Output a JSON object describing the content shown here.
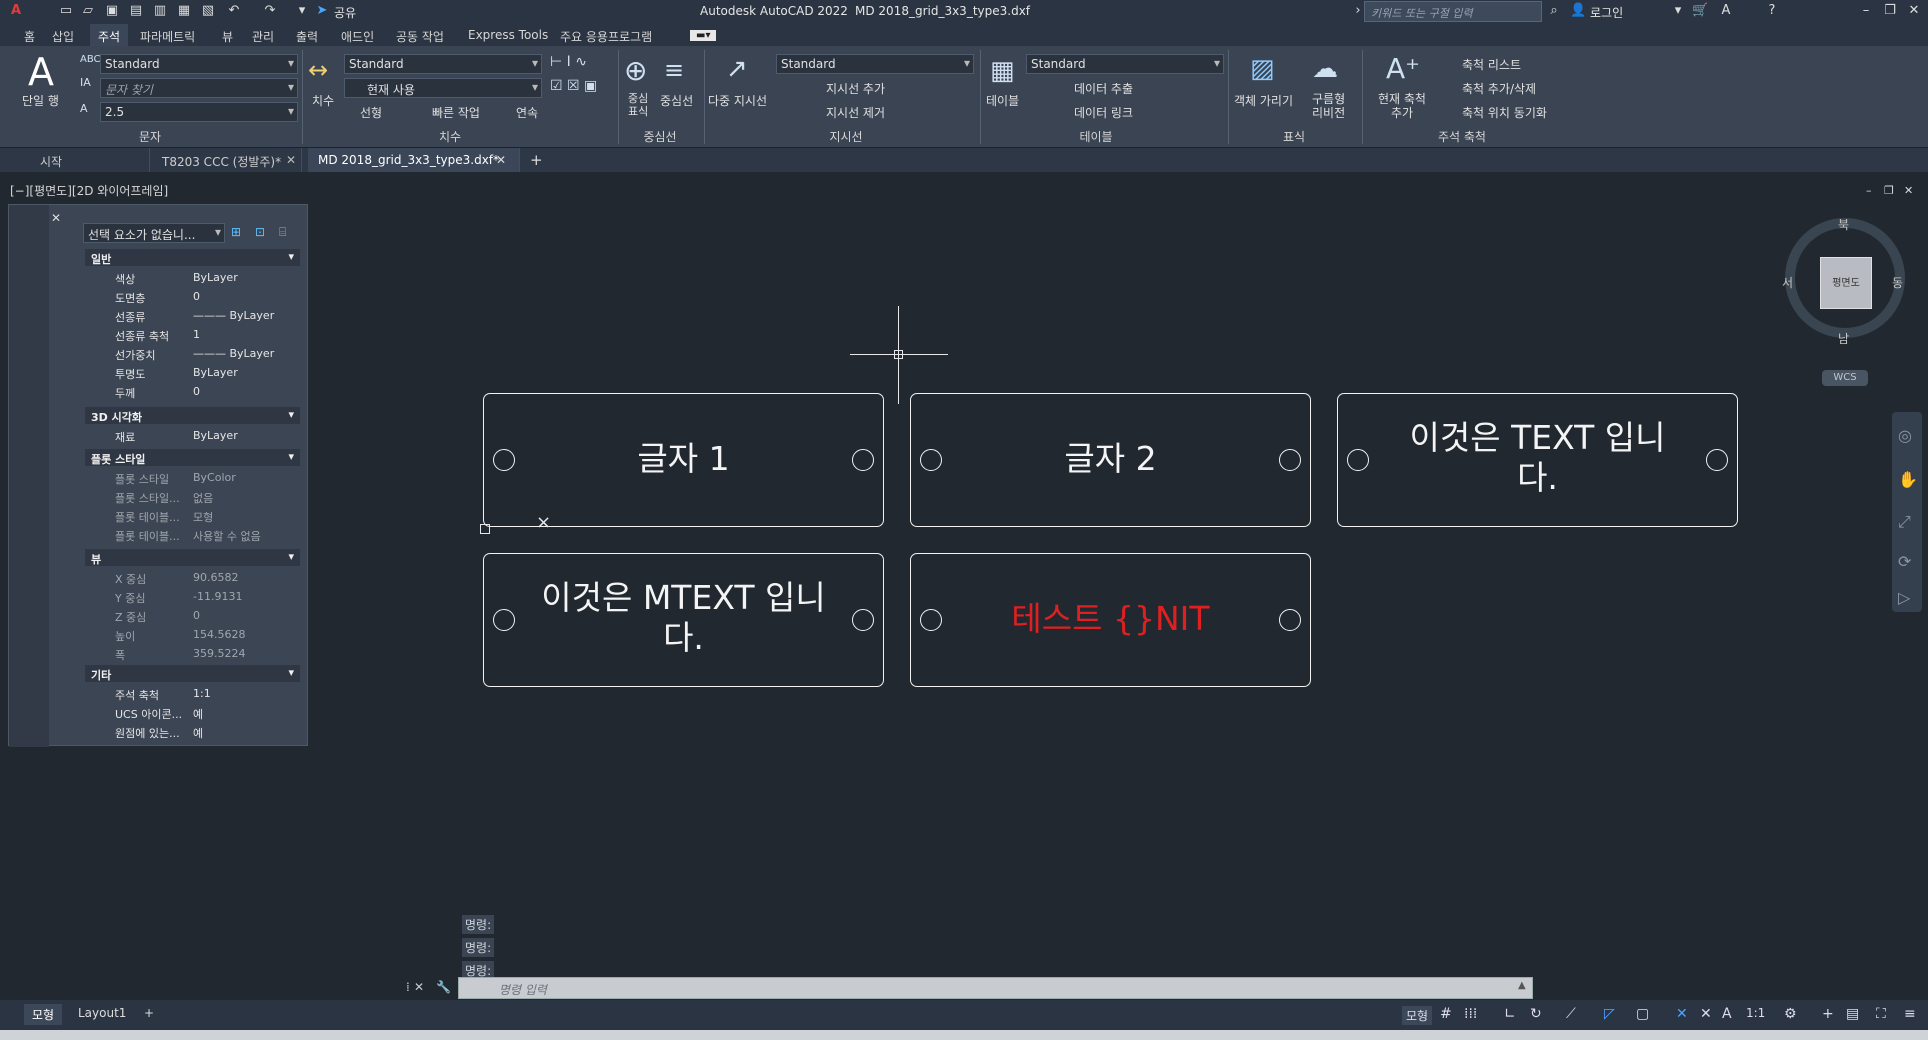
{
  "app": {
    "title": "Autodesk AutoCAD 2022",
    "filename": "MD 2018_grid_3x3_type3.dxf",
    "share": "공유",
    "search_placeholder": "키워드 또는 구절 입력",
    "login": "로그인"
  },
  "ribbon_tabs": [
    "홈",
    "삽입",
    "주석",
    "파라메트릭",
    "뷰",
    "관리",
    "출력",
    "애드인",
    "공동 작업",
    "Express Tools",
    "주요 응용프로그램"
  ],
  "ribbon": {
    "text": {
      "big": "단일 행",
      "style": "Standard",
      "find": "문자 찾기",
      "height": "2.5",
      "title": "문자"
    },
    "dim": {
      "big": "치수",
      "style": "Standard",
      "layer": "현재 사용",
      "linear": "선형",
      "quick": "빠른 작업",
      "continue": "연속",
      "title": "치수"
    },
    "center": {
      "mark": "중심 표식",
      "line": "중심선",
      "title": "중심선"
    },
    "leader": {
      "multi": "다중 지시선",
      "style": "Standard",
      "add": "지시선 추가",
      "remove": "지시선 제거",
      "title": "지시선"
    },
    "table": {
      "big": "테이블",
      "style": "Standard",
      "extract": "데이터 추출",
      "link": "데이터 링크",
      "title": "테이블"
    },
    "markup": {
      "wipeout": "객체 가리기",
      "revcloud": "구름형 리비전",
      "title": "표식"
    },
    "scale": {
      "add": "현재 축척 추가",
      "list": "축척 리스트",
      "addremove": "축척 추가/삭제",
      "sync": "축척 위치 동기화",
      "title": "주석 축척"
    }
  },
  "file_tabs": [
    {
      "label": "시작"
    },
    {
      "label": "T8203 CCC (정발주)*"
    },
    {
      "label": "MD 2018_grid_3x3_type3.dxf*"
    }
  ],
  "viewport_label": "[−][평면도][2D 와이어프레임]",
  "properties": {
    "selection": "선택 요소가 없습니...",
    "sections": {
      "general": "일반",
      "vis3d": "3D 시각화",
      "plot": "플롯 스타일",
      "view": "뷰",
      "misc": "기타"
    },
    "general": [
      [
        "색상",
        "ByLayer"
      ],
      [
        "도면층",
        "0"
      ],
      [
        "선종류",
        "——— ByLayer"
      ],
      [
        "선종류 축척",
        "1"
      ],
      [
        "선가중치",
        "——— ByLayer"
      ],
      [
        "투명도",
        "ByLayer"
      ],
      [
        "두께",
        "0"
      ]
    ],
    "vis3d": [
      [
        "재료",
        "ByLayer"
      ]
    ],
    "plot": [
      [
        "플롯 스타일",
        "ByColor"
      ],
      [
        "플롯 스타일...",
        "없음"
      ],
      [
        "플롯 테이블...",
        "모형"
      ],
      [
        "플롯 테이블...",
        "사용할 수 없음"
      ]
    ],
    "view": [
      [
        "X 중심",
        "90.6582"
      ],
      [
        "Y 중심",
        "-11.9131"
      ],
      [
        "Z 중심",
        "0"
      ],
      [
        "높이",
        "154.5628"
      ],
      [
        "폭",
        "359.5224"
      ]
    ],
    "misc": [
      [
        "주석 축척",
        "1:1"
      ],
      [
        "UCS 아이콘...",
        "예"
      ],
      [
        "원점에 있는...",
        "예"
      ]
    ]
  },
  "drawing": {
    "boxes": [
      {
        "text": "글자 1"
      },
      {
        "text": "글자 2"
      },
      {
        "text": "이것은 TEXT 입니\n다."
      },
      {
        "text": "이것은 MTEXT 입니\n다."
      },
      {
        "text": "테스트 {}NIT",
        "color": "#e02020"
      }
    ]
  },
  "viewcube": {
    "north": "북",
    "south": "남",
    "east": "동",
    "west": "서",
    "face": "평면도",
    "wcs": "WCS"
  },
  "command": {
    "history": [
      "명령:",
      "명령:",
      "명령:"
    ],
    "placeholder": "명령 입력"
  },
  "layout_tabs": [
    "모형",
    "Layout1"
  ],
  "status": {
    "model": "모형",
    "scale": "1:1"
  }
}
